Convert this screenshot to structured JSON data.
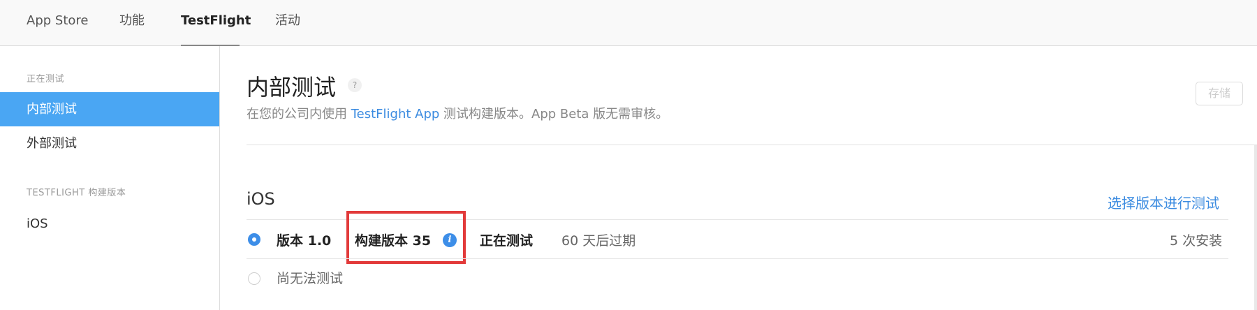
{
  "topbar": {
    "tabs": [
      {
        "label": "App Store"
      },
      {
        "label": "功能"
      },
      {
        "label": "TestFlight"
      },
      {
        "label": "活动"
      }
    ]
  },
  "sidebar": {
    "section1": "正在测试",
    "items": [
      {
        "label": "内部测试"
      },
      {
        "label": "外部测试"
      }
    ],
    "section2": "TESTFLIGHT 构建版本",
    "builds": [
      {
        "label": "iOS"
      }
    ]
  },
  "main": {
    "title": "内部测试",
    "help": "?",
    "subtitle_pre": "在您的公司内使用 ",
    "subtitle_link": "TestFlight App",
    "subtitle_post": " 测试构建版本。App Beta 版无需审核。",
    "save_label": "存储",
    "platform": {
      "title": "iOS",
      "select_link": "选择版本进行测试",
      "rows": [
        {
          "version": "版本 1.0",
          "build": "构建版本 35",
          "info": "i",
          "status": "正在测试",
          "expires": "60 天后过期",
          "installs": "5 次安装"
        }
      ],
      "unavailable": "尚无法测试"
    }
  },
  "colors": {
    "accent": "#3d8ee8",
    "sidebar_active": "#4aa6f3",
    "highlight": "#e23a3a"
  }
}
